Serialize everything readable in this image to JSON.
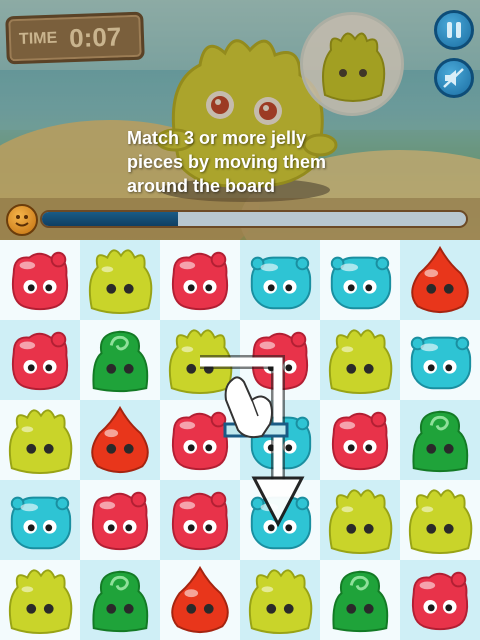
{
  "hud": {
    "time_label": "TIME",
    "time_value": "0:07"
  },
  "hint_text": "Match 3 or more jelly pieces by moving them around the board",
  "progress": {
    "fraction": 0.32
  },
  "colors": {
    "red": "#e8334a",
    "yellow": "#c9d42a",
    "blue": "#2ec4d4",
    "green": "#1fa33a",
    "orange": "#e8361b"
  },
  "board": {
    "rows": [
      [
        "red",
        "yellow",
        "red",
        "blue",
        "blue",
        "orange"
      ],
      [
        "red",
        "green",
        "yellow",
        "red",
        "yellow",
        "blue"
      ],
      [
        "yellow",
        "orange",
        "red",
        "blue",
        "red",
        "green"
      ],
      [
        "blue",
        "red",
        "red",
        "blue",
        "yellow",
        "yellow"
      ],
      [
        "yellow",
        "green",
        "orange",
        "yellow",
        "green",
        "red"
      ]
    ]
  },
  "tutorial": {
    "hand_icon": "pointing-hand-icon",
    "arrow_icon": "arrow-down-icon"
  }
}
